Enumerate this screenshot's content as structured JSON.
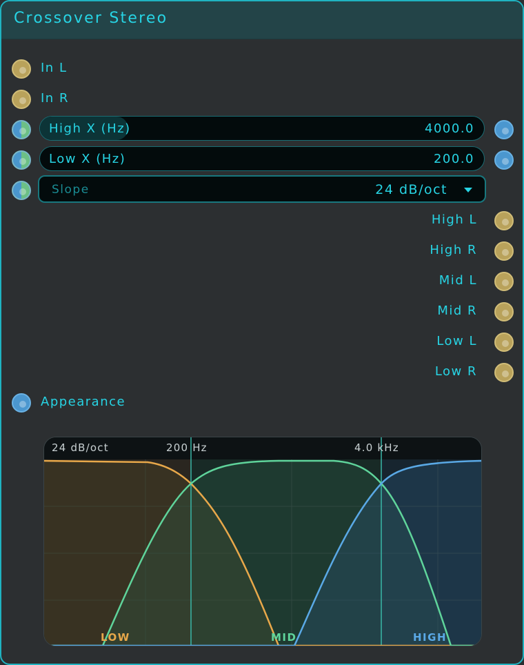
{
  "node": {
    "title": "Crossover Stereo"
  },
  "inputs": [
    {
      "label": "In L"
    },
    {
      "label": "In R"
    }
  ],
  "params": {
    "high_x": {
      "label": "High X (Hz)",
      "value": "4000.0",
      "fill_fraction": 0.2
    },
    "low_x": {
      "label": "Low X (Hz)",
      "value": "200.0",
      "fill_fraction": 0.0
    },
    "slope": {
      "label": "Slope",
      "value": "24 dB/oct"
    }
  },
  "outputs": [
    {
      "label": "High L"
    },
    {
      "label": "High R"
    },
    {
      "label": "Mid L"
    },
    {
      "label": "Mid R"
    },
    {
      "label": "Low L"
    },
    {
      "label": "Low R"
    }
  ],
  "appearance": {
    "label": "Appearance"
  },
  "graph": {
    "slope_label": "24 dB/oct",
    "low_freq_label": "200 Hz",
    "high_freq_label": "4.0 kHz",
    "bands": {
      "low": "LOW",
      "mid": "MID",
      "high": "HIGH"
    },
    "colors": {
      "low": "#e8a84a",
      "mid": "#5fd49b",
      "high": "#5aa9e6",
      "marker": "#39b7a8"
    }
  }
}
